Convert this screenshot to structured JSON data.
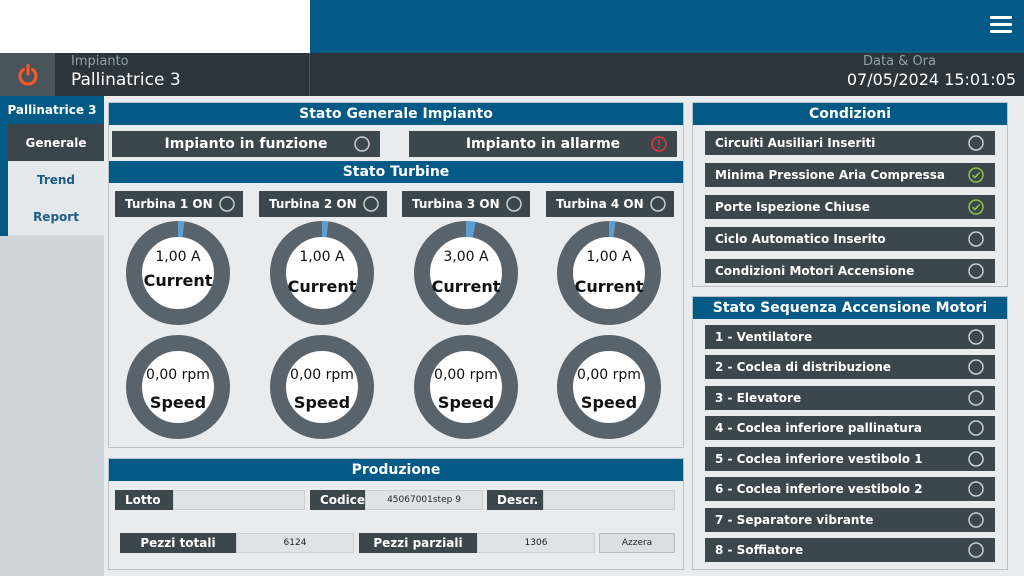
{
  "header": {
    "plant_label": "Impianto",
    "plant_name": "Pallinatrice 3",
    "datetime_label": "Data & Ora",
    "datetime_value": "07/05/2024 15:01:05"
  },
  "sidebar": {
    "title": "Pallinatrice 3",
    "items": [
      {
        "label": "Generale",
        "active": true
      },
      {
        "label": "Trend",
        "active": false
      },
      {
        "label": "Report",
        "active": false
      }
    ]
  },
  "stato_generale": {
    "title": "Stato Generale Impianto",
    "running_label": "Impianto in funzione",
    "alarm_label": "Impianto in allarme"
  },
  "stato_turbine": {
    "title": "Stato Turbine",
    "turbines": [
      {
        "label": "Turbina 1 ON",
        "current": "1,00 A",
        "current_label": "Current",
        "speed": "0,00 rpm",
        "speed_label": "Speed",
        "current_level": 0.02,
        "speed_level": 0.0
      },
      {
        "label": "Turbina 2 ON",
        "current": "1,00 A",
        "current_label": "Current",
        "speed": "0,00 rpm",
        "speed_label": "Speed",
        "current_level": 0.02,
        "speed_level": 0.0
      },
      {
        "label": "Turbina 3 ON",
        "current": "3,00 A",
        "current_label": "Current",
        "speed": "0,00 rpm",
        "speed_label": "Speed",
        "current_level": 0.03,
        "speed_level": 0.0
      },
      {
        "label": "Turbina 4 ON",
        "current": "1,00 A",
        "current_label": "Current",
        "speed": "0,00 rpm",
        "speed_label": "Speed",
        "current_level": 0.02,
        "speed_level": 0.0
      }
    ]
  },
  "produzione": {
    "title": "Produzione",
    "lotto_label": "Lotto",
    "lotto_value": "",
    "codice_label": "Codice",
    "codice_value": "45067001step 9",
    "descr_label": "Descr.",
    "descr_value": "",
    "pezzi_totali_label": "Pezzi totali",
    "pezzi_totali_value": "6124",
    "pezzi_parziali_label": "Pezzi parziali",
    "pezzi_parziali_value": "1306",
    "azzera_label": "Azzera"
  },
  "condizioni": {
    "title": "Condizioni",
    "items": [
      {
        "label": "Circuiti Ausiliari Inseriti",
        "ok": false
      },
      {
        "label": "Minima Pressione Aria Compressa",
        "ok": true
      },
      {
        "label": "Porte Ispezione Chiuse",
        "ok": true
      },
      {
        "label": "Ciclo Automatico Inserito",
        "ok": false
      },
      {
        "label": "Condizioni Motori Accensione",
        "ok": false
      }
    ]
  },
  "sequenza": {
    "title": "Stato Sequenza Accensione Motori",
    "items": [
      {
        "label": "1 - Ventilatore"
      },
      {
        "label": "2 - Coclea di distribuzione"
      },
      {
        "label": "3 - Elevatore"
      },
      {
        "label": "4 - Coclea inferiore pallinatura"
      },
      {
        "label": "5 - Coclea inferiore vestibolo 1"
      },
      {
        "label": "6 - Coclea inferiore vestibolo 2"
      },
      {
        "label": "7 - Separatore vibrante"
      },
      {
        "label": "8 - Soffiatore"
      }
    ]
  },
  "colors": {
    "brand_blue": "#045a87",
    "header_dark": "#2c353c",
    "row_dark": "#3c464d",
    "ok_green": "#8bc34a",
    "alarm_red": "#e53935",
    "power_orange": "#ff5722"
  }
}
